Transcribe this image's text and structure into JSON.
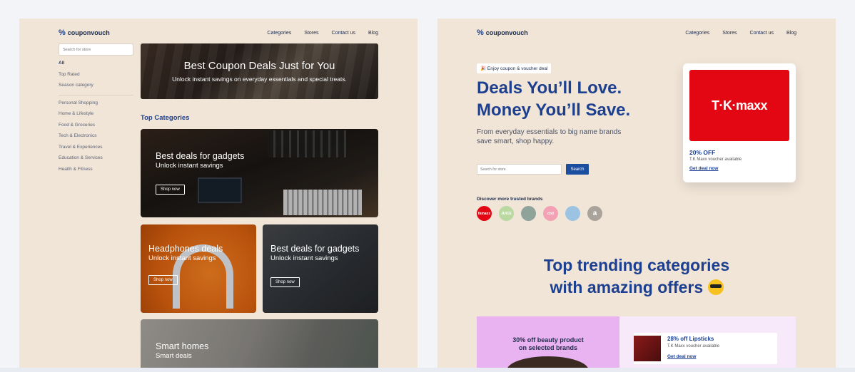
{
  "brand": {
    "name": "couponvouch"
  },
  "nav": [
    "Categories",
    "Stores",
    "Contact us",
    "Blog"
  ],
  "left": {
    "search_placeholder": "Search for store",
    "sidebar_top": [
      "All",
      "Top Rated",
      "Season category"
    ],
    "sidebar_cats": [
      "Personal Shopping",
      "Home & Lifestyle",
      "Food & Groceries",
      "Tech & Electronics",
      "Travel & Experiences",
      "Education & Services",
      "Health & Fitness"
    ],
    "hero": {
      "title": "Best Coupon Deals Just for You",
      "subtitle": "Unlock instant savings on everyday essentials and special treats."
    },
    "section_title": "Top Categories",
    "cards": [
      {
        "title": "Best deals for gadgets",
        "subtitle": "Unlock instant savings",
        "button": "Shop now"
      },
      {
        "title": "Headphones deals",
        "subtitle": "Unlock instant savings",
        "button": "Shop now"
      },
      {
        "title": "Best deals for gadgets",
        "subtitle": "Unlock instant savings",
        "button": "Shop now"
      },
      {
        "title": "Smart homes",
        "subtitle": "Smart deals"
      }
    ]
  },
  "right": {
    "pill": "🎉 Enjoy coupon & voucher deal",
    "headline_1": "Deals You’ll Love.",
    "headline_2": "Money You’ll Save.",
    "sub": "From everyday essentials to big name brands save smart, shop happy.",
    "search_placeholder": "Search for store",
    "search_button": "Search",
    "discover": "Discover more trusted brands",
    "brands": [
      {
        "label": "tkmaxx",
        "color": "#e30613"
      },
      {
        "label": "JUICE",
        "color": "#b9d9a0"
      },
      {
        "label": "",
        "color": "#8fa39a"
      },
      {
        "label": "cbd",
        "color": "#f3a1b4"
      },
      {
        "label": "",
        "color": "#9dc3e3"
      },
      {
        "label": "a",
        "color": "#a9a39b"
      }
    ],
    "offer": {
      "logo": "T·K·maxx",
      "percent": "20% OFF",
      "desc": "T.K Maxx voucher available",
      "link": "Get deal now"
    },
    "trending_1": "Top trending categories",
    "trending_2": "with amazing offers",
    "promo": {
      "left_text_1": "30% off beauty product",
      "left_text_2": "on selected brands",
      "card_title": "28% off Lipsticks",
      "card_desc": "T.K Maxx voucher available",
      "card_link": "Get deal now"
    }
  },
  "colors": {
    "accent": "#1c3f8f",
    "panel_bg": "#f1e5d8",
    "tkmaxx": "#e30613"
  }
}
